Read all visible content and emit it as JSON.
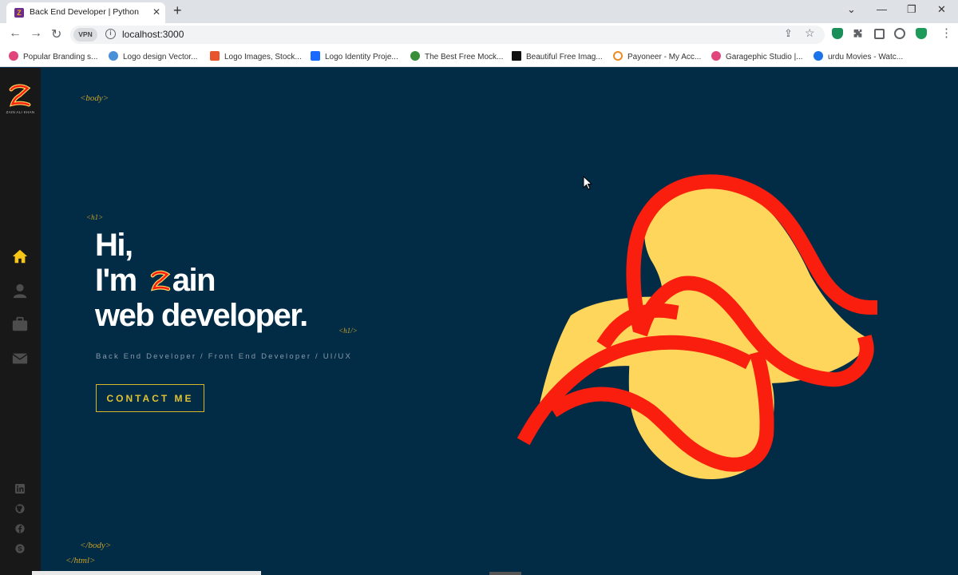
{
  "browser": {
    "tab_title": "Back End Developer | Python Exp",
    "tab_close_glyph": "✕",
    "new_tab_glyph": "+",
    "vpn_label": "VPN",
    "url": "localhost:3000",
    "window_controls": {
      "dropdown_glyph": "⌄",
      "minimize_glyph": "—",
      "restore_glyph": "❐",
      "close_glyph": "✕"
    },
    "nav": {
      "back_glyph": "←",
      "forward_glyph": "→",
      "reload_glyph": "↻",
      "menu_glyph": "⋮"
    },
    "bookmarks": [
      {
        "label": "Popular Branding s...",
        "color": "#e0457b"
      },
      {
        "label": "Logo design Vector...",
        "color": "#4a90d9"
      },
      {
        "label": "Logo Images, Stock...",
        "color": "#e8552d"
      },
      {
        "label": "Logo Identity Proje...",
        "color": "#1769ff"
      },
      {
        "label": "The Best Free Mock...",
        "color": "#3a8d3a"
      },
      {
        "label": "Beautiful Free Imag...",
        "color": "#111111"
      },
      {
        "label": "Payoneer - My Acc...",
        "color": "#f08a24"
      },
      {
        "label": "Garagephic Studio |...",
        "color": "#e0457b"
      },
      {
        "label": "urdu Movies - Watc...",
        "color": "#1a73e8"
      }
    ]
  },
  "sidebar": {
    "logo_name": "ZAIN ALI KHAN",
    "nav_icons": [
      "home-icon",
      "user-icon",
      "briefcase-icon",
      "envelope-icon"
    ],
    "social_icons": [
      "linkedin-icon",
      "github-icon",
      "facebook-icon",
      "skype-icon"
    ],
    "active_color": "#f5c518",
    "inactive_color": "#4d4d4e"
  },
  "hero": {
    "tag_body_open": "<body>",
    "tag_h1_open": "<h1>",
    "line1": "Hi,",
    "line2_prefix": "I'm",
    "line2_suffix": "ain",
    "line3": "web developer.",
    "tag_h1_close": "<h1/>",
    "subtitle": "Back End Developer / Front End Developer / UI/UX",
    "contact_label": "CONTACT ME",
    "tag_body_close": "</body>",
    "tag_html_close": "</html>"
  },
  "colors": {
    "page_bg": "#022b46",
    "accent_yellow": "#ffd65c",
    "accent_red": "#fa1e0e",
    "tag_gold": "#c9a227"
  }
}
